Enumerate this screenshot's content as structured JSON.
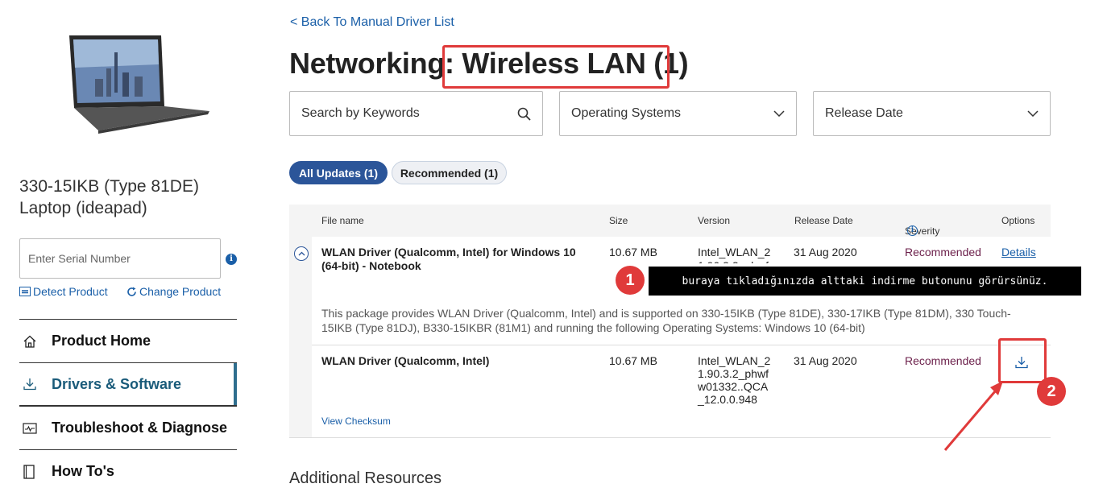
{
  "sidebar": {
    "product_title": "330-15IKB (Type 81DE) Laptop (ideapad)",
    "serial_placeholder": "Enter Serial Number",
    "detect_label": "Detect Product",
    "change_label": "Change Product",
    "nav": [
      {
        "label": "Product Home",
        "icon": "home-icon"
      },
      {
        "label": "Drivers & Software",
        "icon": "download-icon",
        "active": true
      },
      {
        "label": "Troubleshoot & Diagnose",
        "icon": "diagnose-icon"
      },
      {
        "label": "How To's",
        "icon": "book-icon"
      }
    ]
  },
  "main": {
    "back_link": "< Back To Manual Driver List",
    "title": "Networking: Wireless LAN (1)",
    "filters": {
      "search_placeholder": "Search by Keywords",
      "os_label": "Operating Systems",
      "date_label": "Release Date"
    },
    "tabs": [
      {
        "label": "All Updates (1)",
        "active": true
      },
      {
        "label": "Recommended (1)",
        "active": false
      }
    ],
    "table": {
      "headers": [
        "File name",
        "Size",
        "Version",
        "Release Date",
        "Severity",
        "Options"
      ],
      "row": {
        "name": "WLAN Driver (Qualcomm, Intel) for Windows 10 (64-bit) - Notebook",
        "size": "10.67 MB",
        "version": "Intel_WLAN_21.90.3.2_phwf",
        "date": "31 Aug 2020",
        "severity": "Recommended",
        "option": "Details",
        "description": "This package provides WLAN Driver (Qualcomm, Intel) and is supported on 330-15IKB (Type 81DE), 330-17IKB (Type 81DM), 330 Touch-15IKB (Type 81DJ), B330-15IKBR (81M1) and running the following Operating Systems: Windows 10 (64-bit)"
      },
      "subrow": {
        "name": "WLAN Driver (Qualcomm, Intel)",
        "size": "10.67 MB",
        "version": "Intel_WLAN_21.90.3.2_phwfw01332..QCA_12.0.0.948",
        "date": "31 Aug 2020",
        "severity": "Recommended",
        "checksum": "View Checksum"
      }
    },
    "additional": "Additional Resources"
  },
  "annotations": {
    "callout_text": "buraya tıkladığınızda alttaki indirme butonunu görürsünüz.",
    "badge1": "1",
    "badge2": "2",
    "accent": "#e03a3a"
  }
}
